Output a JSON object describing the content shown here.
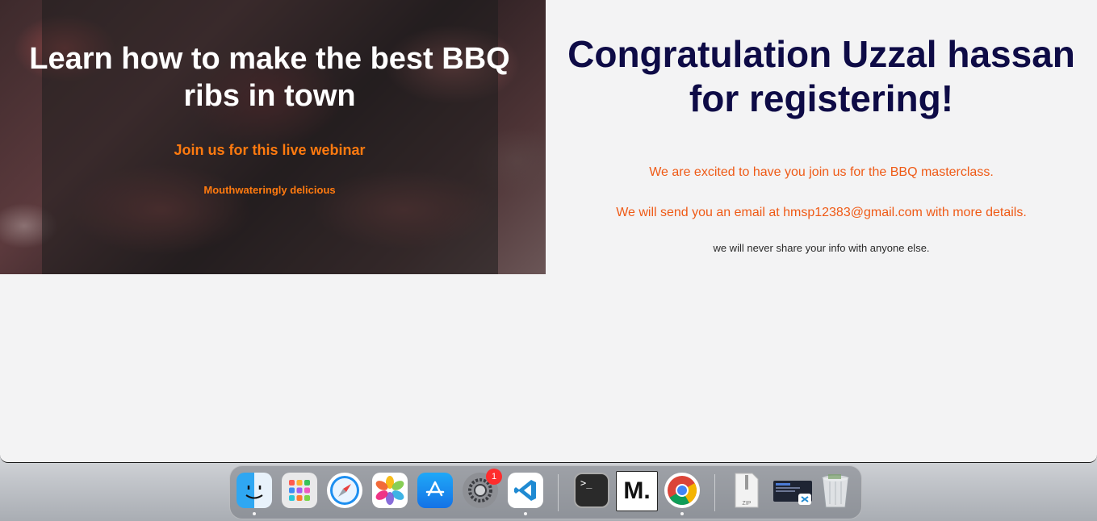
{
  "hero": {
    "title_part1": "Learn how to make ",
    "title_bold": "the best BBQ ribs",
    "title_part2": " in town",
    "subtitle": "Join us for this live webinar",
    "tagline": "Mouthwateringly delicious"
  },
  "confirmation": {
    "heading": "Congratulation Uzzal hassan for registering!",
    "line1": "We are excited to have you join us for the BBQ masterclass.",
    "line2": "We will send you an email at hmsp12383@gmail.com with more details.",
    "note": "we will never share your info with anyone else."
  },
  "colors": {
    "heading": "#0e0b46",
    "accent_orange": "#ef5a16",
    "hero_orange": "#ff7a0f"
  },
  "dock": {
    "items": [
      {
        "name": "Finder",
        "icon": "finder-icon",
        "running": true
      },
      {
        "name": "Launchpad",
        "icon": "launchpad-icon",
        "running": false
      },
      {
        "name": "Safari",
        "icon": "safari-icon",
        "running": false
      },
      {
        "name": "Photos",
        "icon": "photos-icon",
        "running": false
      },
      {
        "name": "App Store",
        "icon": "app-store-icon",
        "running": false
      },
      {
        "name": "System Preferences",
        "icon": "settings-icon",
        "running": false,
        "badge": "1"
      },
      {
        "name": "Visual Studio Code",
        "icon": "vscode-icon",
        "running": true
      },
      {
        "name": "Terminal",
        "icon": "terminal-icon",
        "running": false
      },
      {
        "name": "Medium",
        "icon": "medium-icon",
        "running": false,
        "label": "M."
      },
      {
        "name": "Google Chrome",
        "icon": "chrome-icon",
        "running": true
      },
      {
        "name": "Archive",
        "icon": "zip-file-icon",
        "running": false,
        "label": "ZIP"
      },
      {
        "name": "Screenshot",
        "icon": "screenshot-icon",
        "running": false
      },
      {
        "name": "Trash",
        "icon": "trash-icon",
        "running": false
      }
    ],
    "terminal_prompt": ">_"
  }
}
